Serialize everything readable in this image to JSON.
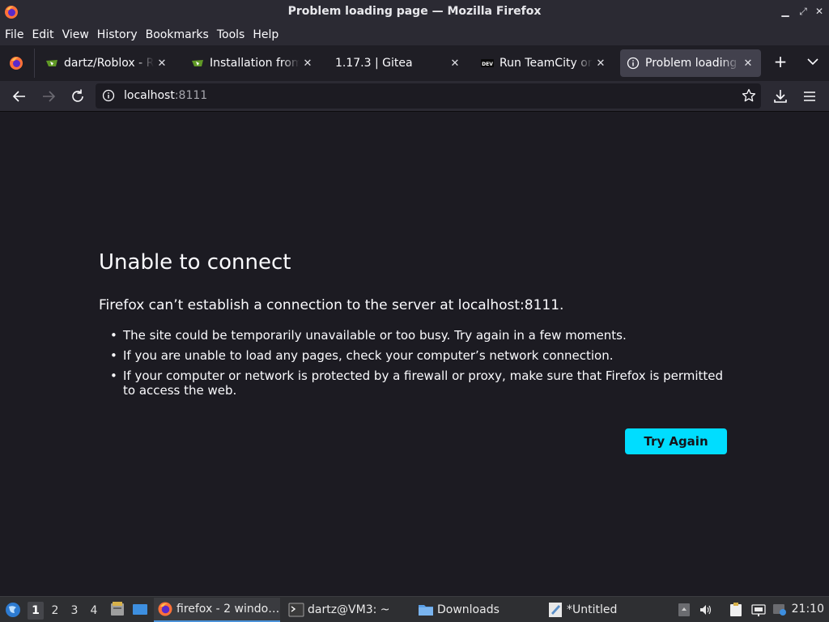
{
  "window": {
    "title": "Problem loading page — Mozilla Firefox"
  },
  "menubar": {
    "items": [
      "File",
      "Edit",
      "View",
      "History",
      "Bookmarks",
      "Tools",
      "Help"
    ]
  },
  "tabs": [
    {
      "label": "dartz/Roblox - Roblox",
      "icon": "gitea-icon",
      "active": false
    },
    {
      "label": "Installation from binary",
      "icon": "gitea-icon",
      "active": false
    },
    {
      "label": "1.17.3 | Gitea",
      "icon": "none",
      "active": false
    },
    {
      "label": "Run TeamCity on Docker",
      "icon": "dev-icon",
      "active": false
    },
    {
      "label": "Problem loading page",
      "icon": "info-icon",
      "active": true
    }
  ],
  "navbar": {
    "url_host": "localhost",
    "url_port": ":8111"
  },
  "error_page": {
    "title": "Unable to connect",
    "short_desc": "Firefox can’t establish a connection to the server at localhost:8111.",
    "bullets": [
      "The site could be temporarily unavailable or too busy. Try again in a few moments.",
      "If you are unable to load any pages, check your computer’s network connection.",
      "If your computer or network is protected by a firewall or proxy, make sure that Firefox is permitted to access the web."
    ],
    "try_again_label": "Try Again"
  },
  "taskbar": {
    "workspaces": [
      "1",
      "2",
      "3",
      "4"
    ],
    "current_workspace": "1",
    "tasks": [
      {
        "label": "firefox - 2 windo…",
        "icon": "firefox-icon",
        "active": true
      },
      {
        "label": "dartz@VM3: ~",
        "icon": "terminal-icon",
        "active": false
      },
      {
        "label": "Downloads",
        "icon": "folder-icon",
        "active": false
      },
      {
        "label": "*Untitled",
        "icon": "text-editor-icon",
        "active": false
      }
    ],
    "clock": "21:10"
  },
  "colors": {
    "accent": "#00ddff",
    "page_bg": "#1c1b22",
    "chrome_bg": "#2b2a33"
  }
}
